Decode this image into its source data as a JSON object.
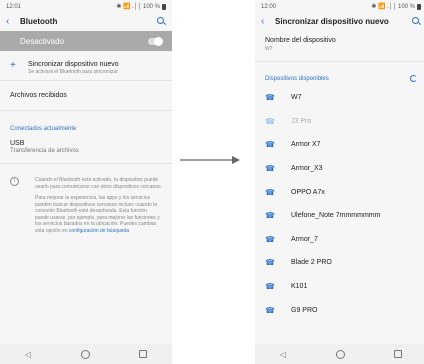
{
  "left": {
    "status": {
      "time": "12:01",
      "indicators": "✱ 📶 .││ 100 %"
    },
    "appbar": {
      "title": "Bluetooth"
    },
    "toggle": {
      "label": "Desactivado",
      "state": "off"
    },
    "pair_new": {
      "title": "Sincronizar dispositivo nuevo",
      "subtitle": "Se activará el Bluetooth para sincronizar"
    },
    "received_files": "Archivos recibidos",
    "connected_header": "Conectados actualmente",
    "usb": {
      "title": "USB",
      "subtitle": "Transferencia de archivos"
    },
    "info": {
      "p1": "Cuando el Bluetooth está activado, tu dispositivo puede usarlo para comunicarse con otros dispositivos cercanos.",
      "p2": "Para mejorar la experiencia, las apps y los servicios pueden buscar dispositivos cercanos incluso cuando la conexión Bluetooth esté desactivada. Esta función puede usarse, por ejemplo, para mejorar las funciones y los servicios basados en la ubicación. Puedes cambiar esta opción en",
      "link": "configuración de búsqueda"
    }
  },
  "right": {
    "status": {
      "time": "12:00",
      "indicators": "✱ 📶 .││ 100 %"
    },
    "appbar": {
      "title": "Sincronizar dispositivo nuevo"
    },
    "device_name": {
      "label": "Nombre del dispositivo",
      "value": "W7"
    },
    "available_header": "Dispositivos disponibles",
    "devices": [
      {
        "name": "W7",
        "dim": false
      },
      {
        "name": "J3 Pro",
        "dim": true
      },
      {
        "name": "Armor X7",
        "dim": false
      },
      {
        "name": "Armor_X3",
        "dim": false
      },
      {
        "name": "OPPO A7x",
        "dim": false
      },
      {
        "name": "Ulefone_Note 7mmmmmmm",
        "dim": false
      },
      {
        "name": "Armor_7",
        "dim": false
      },
      {
        "name": "Blade 2 PRO",
        "dim": false
      },
      {
        "name": "K101",
        "dim": false
      },
      {
        "name": "G9 PRO",
        "dim": false
      }
    ]
  },
  "navbar": {
    "back": "◁",
    "home": "",
    "recents": ""
  },
  "colors": {
    "accent": "#2a72c9",
    "toggle_bar": "#a9a9a9"
  },
  "icons": [
    "back-arrow-icon",
    "search-icon",
    "plus-icon",
    "info-icon",
    "phone-icon",
    "spinner-icon"
  ]
}
